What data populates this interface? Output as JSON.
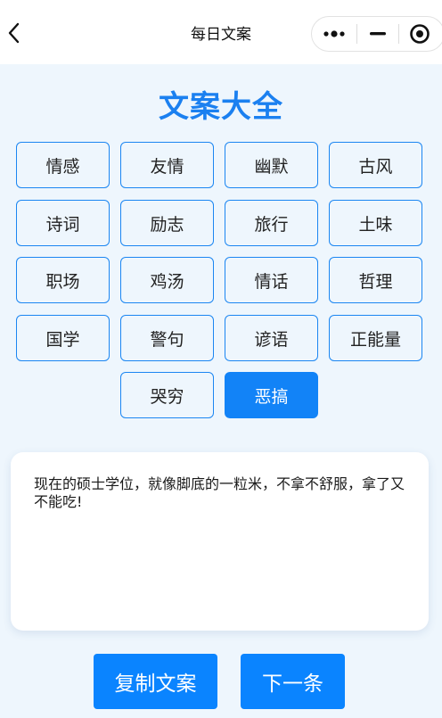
{
  "navbar": {
    "title": "每日文案",
    "back_icon": "chevron-left-icon",
    "more_icon": "more-dots-icon",
    "minimize_icon": "minimize-icon",
    "close_icon": "target-circle-icon"
  },
  "page_title": "文案大全",
  "categories": [
    {
      "label": "情感",
      "selected": false
    },
    {
      "label": "友情",
      "selected": false
    },
    {
      "label": "幽默",
      "selected": false
    },
    {
      "label": "古风",
      "selected": false
    },
    {
      "label": "诗词",
      "selected": false
    },
    {
      "label": "励志",
      "selected": false
    },
    {
      "label": "旅行",
      "selected": false
    },
    {
      "label": "土味",
      "selected": false
    },
    {
      "label": "职场",
      "selected": false
    },
    {
      "label": "鸡汤",
      "selected": false
    },
    {
      "label": "情话",
      "selected": false
    },
    {
      "label": "哲理",
      "selected": false
    },
    {
      "label": "国学",
      "selected": false
    },
    {
      "label": "警句",
      "selected": false
    },
    {
      "label": "谚语",
      "selected": false
    },
    {
      "label": "正能量",
      "selected": false
    },
    {
      "label": "哭穷",
      "selected": false
    },
    {
      "label": "恶搞",
      "selected": true
    }
  ],
  "quote": {
    "text": "现在的硕士学位，就像脚底的一粒米，不拿不舒服，拿了又不能吃!"
  },
  "actions": {
    "copy_label": "复制文案",
    "next_label": "下一条"
  },
  "colors": {
    "accent": "#1b80f0",
    "button": "#0a84ff",
    "background": "#eef6fd"
  }
}
